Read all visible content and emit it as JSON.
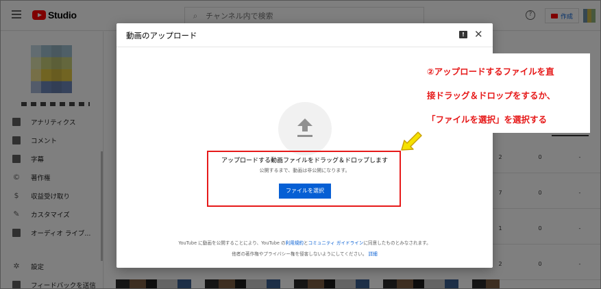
{
  "header": {
    "app_name": "Studio",
    "search_placeholder": "チャンネル内で検索",
    "create_label": "作成"
  },
  "sidebar": {
    "items": [
      {
        "label": "アナリティクス",
        "icon": "analytics-icon"
      },
      {
        "label": "コメント",
        "icon": "comment-icon"
      },
      {
        "label": "字幕",
        "icon": "subtitles-icon"
      },
      {
        "label": "著作権",
        "icon": "copyright-icon"
      },
      {
        "label": "収益受け取り",
        "icon": "dollar-icon"
      },
      {
        "label": "カスタマイズ",
        "icon": "customize-icon"
      },
      {
        "label": "オーディオ ライブ...",
        "icon": "audio-library-icon"
      }
    ],
    "bottom_items": [
      {
        "label": "設定",
        "icon": "gear-icon"
      },
      {
        "label": "フィードバックを送信",
        "icon": "feedback-icon"
      }
    ]
  },
  "table": {
    "rows": [
      {
        "c1": "2",
        "c2": "0",
        "c3": "-"
      },
      {
        "c1": "7",
        "c2": "0",
        "c3": "-"
      },
      {
        "c1": "1",
        "c2": "0",
        "c3": "-"
      },
      {
        "c1": "2",
        "c2": "0",
        "c3": "-"
      }
    ]
  },
  "dialog": {
    "title": "動画のアップロード",
    "drop_text": "アップロードする動画ファイルをドラッグ＆ドロップします",
    "private_note": "公開するまで、動画は非公開になります。",
    "select_button": "ファイルを選択",
    "terms_prefix": "YouTube に動画を公開することにより、YouTube の",
    "terms_link": "利用規約",
    "terms_and": "と",
    "guidelines_link": "コミュニティ ガイドライン",
    "terms_suffix": "に同意したものとみなされます。",
    "rights_note": "他者の著作権やプライバシー権を侵害しないようにしてください。",
    "details_link": "詳細"
  },
  "annotation": {
    "lines": [
      "②アップロードするファイルを直",
      "接ドラッグ＆ドロップをするか、",
      "「ファイルを選択」を選択する"
    ],
    "colors": {
      "red": "#e61919",
      "arrow": "#f5e100"
    }
  }
}
